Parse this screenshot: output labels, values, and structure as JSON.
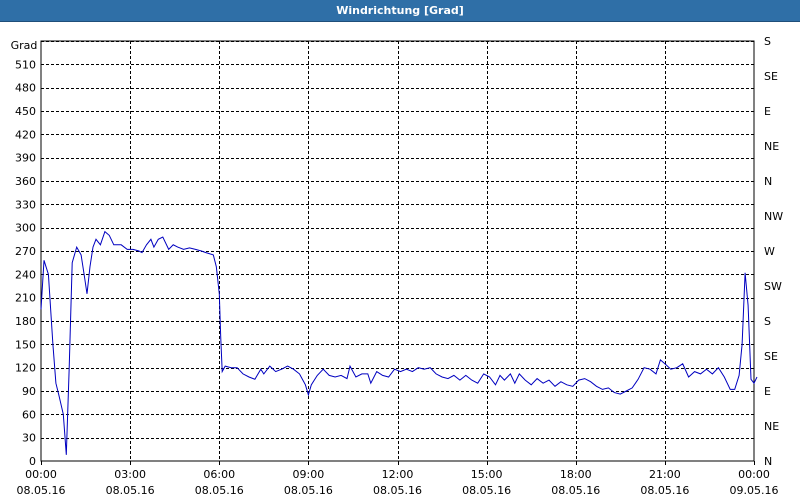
{
  "window": {
    "title": "Windrichtung [Grad]"
  },
  "colors": {
    "titlebar": "#2f6fa7",
    "series": "#0000c0",
    "grid": "#000000",
    "background": "#ffffff"
  },
  "chart_data": {
    "type": "line",
    "title": "Windrichtung [Grad]",
    "ylabel": "Grad",
    "ylim": [
      0,
      540
    ],
    "grid": true,
    "y_ticks": [
      0,
      30,
      60,
      90,
      120,
      150,
      180,
      210,
      240,
      270,
      300,
      330,
      360,
      390,
      420,
      450,
      480,
      510
    ],
    "right_ticks": [
      {
        "value": 0,
        "label": "N"
      },
      {
        "value": 45,
        "label": "NE"
      },
      {
        "value": 90,
        "label": "E"
      },
      {
        "value": 135,
        "label": "SE"
      },
      {
        "value": 180,
        "label": "S"
      },
      {
        "value": 225,
        "label": "SW"
      },
      {
        "value": 270,
        "label": "W"
      },
      {
        "value": 315,
        "label": "NW"
      },
      {
        "value": 360,
        "label": "N"
      },
      {
        "value": 405,
        "label": "NE"
      },
      {
        "value": 450,
        "label": "E"
      },
      {
        "value": 495,
        "label": "SE"
      },
      {
        "value": 540,
        "label": "S"
      }
    ],
    "x_ticks": [
      {
        "hour": 0,
        "time": "00:00",
        "date": "08.05.16"
      },
      {
        "hour": 3,
        "time": "03:00",
        "date": "08.05.16"
      },
      {
        "hour": 6,
        "time": "06:00",
        "date": "08.05.16"
      },
      {
        "hour": 9,
        "time": "09:00",
        "date": "08.05.16"
      },
      {
        "hour": 12,
        "time": "12:00",
        "date": "08.05.16"
      },
      {
        "hour": 15,
        "time": "15:00",
        "date": "08.05.16"
      },
      {
        "hour": 18,
        "time": "18:00",
        "date": "08.05.16"
      },
      {
        "hour": 21,
        "time": "21:00",
        "date": "08.05.16"
      },
      {
        "hour": 24,
        "time": "00:00",
        "date": "09.05.16"
      }
    ],
    "x_range_hours": [
      0,
      24
    ],
    "series": [
      {
        "points": [
          [
            0.0,
            195
          ],
          [
            0.1,
            258
          ],
          [
            0.25,
            240
          ],
          [
            0.4,
            150
          ],
          [
            0.5,
            100
          ],
          [
            0.6,
            85
          ],
          [
            0.75,
            60
          ],
          [
            0.85,
            8
          ],
          [
            0.95,
            120
          ],
          [
            1.05,
            255
          ],
          [
            1.2,
            275
          ],
          [
            1.35,
            265
          ],
          [
            1.45,
            240
          ],
          [
            1.55,
            215
          ],
          [
            1.65,
            250
          ],
          [
            1.75,
            275
          ],
          [
            1.85,
            285
          ],
          [
            2.0,
            278
          ],
          [
            2.15,
            295
          ],
          [
            2.3,
            290
          ],
          [
            2.45,
            278
          ],
          [
            2.7,
            278
          ],
          [
            2.9,
            272
          ],
          [
            3.1,
            272
          ],
          [
            3.3,
            270
          ],
          [
            3.4,
            268
          ],
          [
            3.55,
            278
          ],
          [
            3.7,
            285
          ],
          [
            3.8,
            275
          ],
          [
            3.95,
            285
          ],
          [
            4.1,
            288
          ],
          [
            4.3,
            272
          ],
          [
            4.45,
            278
          ],
          [
            4.6,
            275
          ],
          [
            4.8,
            272
          ],
          [
            5.0,
            274
          ],
          [
            5.2,
            272
          ],
          [
            5.4,
            270
          ],
          [
            5.55,
            268
          ],
          [
            5.8,
            265
          ],
          [
            5.9,
            250
          ],
          [
            6.0,
            215
          ],
          [
            6.05,
            160
          ],
          [
            6.1,
            115
          ],
          [
            6.2,
            122
          ],
          [
            6.4,
            120
          ],
          [
            6.6,
            120
          ],
          [
            6.8,
            112
          ],
          [
            7.0,
            108
          ],
          [
            7.2,
            105
          ],
          [
            7.4,
            118
          ],
          [
            7.5,
            112
          ],
          [
            7.7,
            122
          ],
          [
            7.9,
            115
          ],
          [
            8.1,
            118
          ],
          [
            8.3,
            122
          ],
          [
            8.5,
            118
          ],
          [
            8.7,
            112
          ],
          [
            8.9,
            98
          ],
          [
            9.0,
            85
          ],
          [
            9.1,
            98
          ],
          [
            9.3,
            110
          ],
          [
            9.5,
            118
          ],
          [
            9.7,
            110
          ],
          [
            9.9,
            108
          ],
          [
            10.1,
            110
          ],
          [
            10.3,
            106
          ],
          [
            10.4,
            122
          ],
          [
            10.6,
            108
          ],
          [
            10.8,
            112
          ],
          [
            11.0,
            112
          ],
          [
            11.1,
            100
          ],
          [
            11.3,
            115
          ],
          [
            11.5,
            110
          ],
          [
            11.7,
            108
          ],
          [
            11.9,
            118
          ],
          [
            12.1,
            115
          ],
          [
            12.3,
            118
          ],
          [
            12.5,
            115
          ],
          [
            12.7,
            120
          ],
          [
            12.9,
            118
          ],
          [
            13.1,
            120
          ],
          [
            13.3,
            112
          ],
          [
            13.5,
            108
          ],
          [
            13.7,
            106
          ],
          [
            13.9,
            110
          ],
          [
            14.1,
            104
          ],
          [
            14.3,
            110
          ],
          [
            14.5,
            104
          ],
          [
            14.7,
            100
          ],
          [
            14.9,
            112
          ],
          [
            15.1,
            108
          ],
          [
            15.3,
            98
          ],
          [
            15.45,
            110
          ],
          [
            15.6,
            104
          ],
          [
            15.8,
            112
          ],
          [
            15.95,
            100
          ],
          [
            16.1,
            112
          ],
          [
            16.3,
            104
          ],
          [
            16.5,
            98
          ],
          [
            16.7,
            106
          ],
          [
            16.9,
            100
          ],
          [
            17.1,
            104
          ],
          [
            17.3,
            96
          ],
          [
            17.5,
            102
          ],
          [
            17.7,
            98
          ],
          [
            17.9,
            96
          ],
          [
            18.1,
            104
          ],
          [
            18.3,
            106
          ],
          [
            18.5,
            102
          ],
          [
            18.7,
            96
          ],
          [
            18.9,
            92
          ],
          [
            19.1,
            94
          ],
          [
            19.3,
            88
          ],
          [
            19.5,
            86
          ],
          [
            19.7,
            90
          ],
          [
            19.9,
            94
          ],
          [
            20.1,
            105
          ],
          [
            20.3,
            120
          ],
          [
            20.5,
            118
          ],
          [
            20.7,
            112
          ],
          [
            20.85,
            130
          ],
          [
            21.0,
            125
          ],
          [
            21.2,
            118
          ],
          [
            21.4,
            120
          ],
          [
            21.6,
            125
          ],
          [
            21.8,
            108
          ],
          [
            22.0,
            115
          ],
          [
            22.2,
            112
          ],
          [
            22.4,
            118
          ],
          [
            22.6,
            112
          ],
          [
            22.8,
            120
          ],
          [
            23.0,
            108
          ],
          [
            23.2,
            92
          ],
          [
            23.35,
            92
          ],
          [
            23.5,
            110
          ],
          [
            23.6,
            150
          ],
          [
            23.7,
            242
          ],
          [
            23.8,
            200
          ],
          [
            23.9,
            105
          ],
          [
            24.0,
            100
          ],
          [
            24.1,
            108
          ]
        ]
      }
    ]
  }
}
